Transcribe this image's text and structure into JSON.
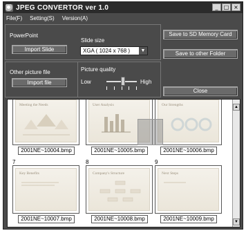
{
  "window": {
    "title": "JPEG CONVERTOR ver 1.0"
  },
  "window_controls": {
    "minimize": "_",
    "maximize": "□",
    "close": "×"
  },
  "menu": [
    {
      "label": "File(F)"
    },
    {
      "label": "Setting(S)"
    },
    {
      "label": "Version(A)"
    }
  ],
  "powerpoint": {
    "label": "PowerPoint",
    "import_button": "Import Slide",
    "slide_size_label": "Slide size",
    "slide_size_value": "XGA  ( 1024 x 768 )"
  },
  "picture": {
    "label": "Other picture file",
    "import_button": "Import file",
    "quality_label": "Picture quality",
    "low_label": "Low",
    "high_label": "High",
    "quality_level_fraction": 0.55
  },
  "actions": {
    "save_sd": "Save to SD Memory Card",
    "save_folder": "Save to other Folder",
    "close": "Close"
  },
  "scroll": {
    "up": "▲",
    "down": "▼"
  },
  "thumbnails": [
    {
      "number": "",
      "slide_title": "Meeting the Needs",
      "caption": "2001NE~10004.bmp"
    },
    {
      "number": "",
      "slide_title": "User Analysis",
      "caption": "2001NE~10005.bmp"
    },
    {
      "number": "",
      "slide_title": "Our Strengths",
      "caption": "2001NE~10006.bmp"
    },
    {
      "number": "7",
      "slide_title": "Key Benefits",
      "caption": "2001NE~10007.bmp"
    },
    {
      "number": "8",
      "slide_title": "Company's Structure",
      "caption": "2001NE~10008.bmp"
    },
    {
      "number": "9",
      "slide_title": "Next Steps",
      "caption": "2001NE~10009.bmp"
    }
  ]
}
